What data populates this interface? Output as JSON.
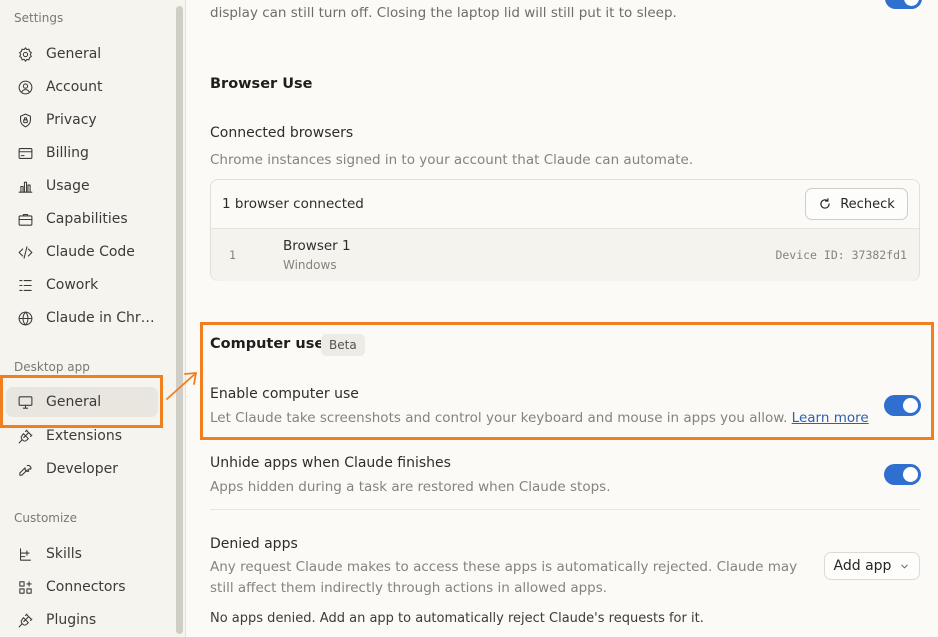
{
  "sidebar": {
    "settings_label": "Settings",
    "settings_items": [
      {
        "label": "General",
        "icon": "gear-icon"
      },
      {
        "label": "Account",
        "icon": "user-circle-icon"
      },
      {
        "label": "Privacy",
        "icon": "shield-lock-icon"
      },
      {
        "label": "Billing",
        "icon": "credit-card-icon"
      },
      {
        "label": "Usage",
        "icon": "bar-chart-icon"
      },
      {
        "label": "Capabilities",
        "icon": "briefcase-icon"
      },
      {
        "label": "Claude Code",
        "icon": "code-icon"
      },
      {
        "label": "Cowork",
        "icon": "list-icon"
      },
      {
        "label": "Claude in Chr…",
        "icon": "globe-icon"
      }
    ],
    "desktop_label": "Desktop app",
    "desktop_items": [
      {
        "label": "General",
        "icon": "monitor-icon",
        "active": true
      },
      {
        "label": "Extensions",
        "icon": "plug-icon"
      },
      {
        "label": "Developer",
        "icon": "wrench-icon"
      }
    ],
    "customize_label": "Customize",
    "customize_items": [
      {
        "label": "Skills",
        "icon": "skills-icon"
      },
      {
        "label": "Connectors",
        "icon": "grid-plus-icon"
      },
      {
        "label": "Plugins",
        "icon": "plug-icon"
      }
    ]
  },
  "main": {
    "top_cutoff_text": "display can still turn off. Closing the laptop lid will still put it to sleep.",
    "browser_use": {
      "heading": "Browser Use",
      "connected_label": "Connected browsers",
      "connected_desc": "Chrome instances signed in to your account that Claude can automate.",
      "count_text": "1 browser connected",
      "recheck_label": "Recheck",
      "browsers": [
        {
          "index": "1",
          "name": "Browser 1",
          "os": "Windows",
          "device": "Device ID: 37382fd1"
        }
      ]
    },
    "computer_use": {
      "heading": "Computer use",
      "badge": "Beta",
      "enable_label": "Enable computer use",
      "enable_desc": "Let Claude take screenshots and control your keyboard and mouse in apps you allow.",
      "learn_more": "Learn more",
      "enable_on": true,
      "unhide_label": "Unhide apps when Claude finishes",
      "unhide_desc": "Apps hidden during a task are restored when Claude stops.",
      "unhide_on": true,
      "denied_label": "Denied apps",
      "denied_desc_1": "Any request Claude makes to access these apps is automatically rejected. Claude may",
      "denied_desc_2": "still affect them indirectly through actions in allowed apps.",
      "add_app_label": "Add app",
      "no_apps_text": "No apps denied. Add an app to automatically reject Claude's requests for it."
    }
  },
  "colors": {
    "highlight": "#f07f20",
    "toggle_on": "#2f6fcf"
  }
}
